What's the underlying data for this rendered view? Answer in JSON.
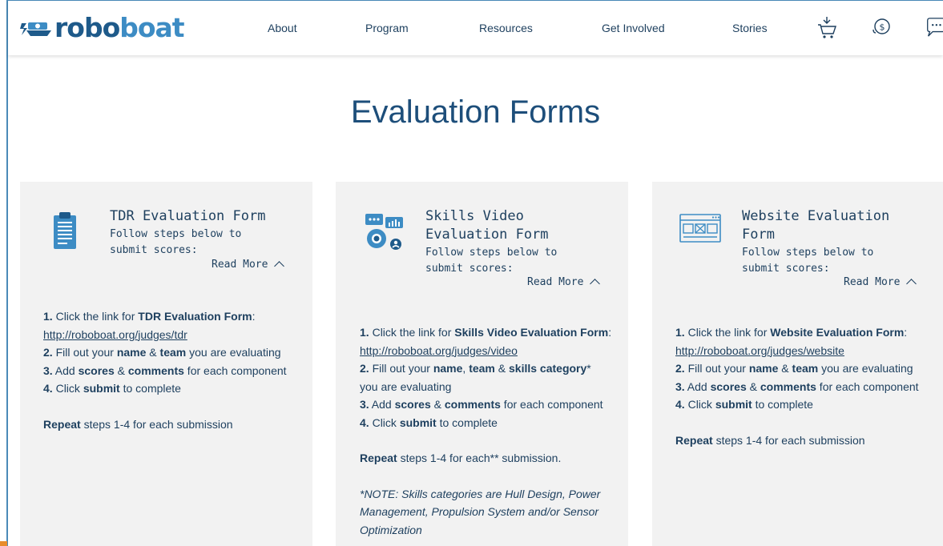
{
  "brand": {
    "logo_part1": "robo",
    "logo_part2": "boat"
  },
  "nav": {
    "items": [
      "About",
      "Program",
      "Resources",
      "Get Involved",
      "Stories"
    ],
    "icons": [
      "cart-icon",
      "donate-coin-icon",
      "chat-icon"
    ]
  },
  "page_title": "Evaluation Forms",
  "colors": {
    "primary": "#1d4e7a",
    "text": "#1d3f5e",
    "card_bg": "#f2f2f2",
    "icon_blue": "#3d8cc4"
  },
  "cards": [
    {
      "title_l1": "TDR Evaluation Form",
      "sub_l1": "Follow steps below to",
      "sub_l2": "submit scores:",
      "read_more": "Read More",
      "s1_num": "1.",
      "s1_a": " Click the link for ",
      "s1_b": "TDR Evaluation Form",
      "s1_c": ":",
      "link": "http://roboboat.org/judges/tdr ",
      "s2_num": "2.",
      "s2_a": " Fill out your ",
      "s2_b": "name",
      "s2_c": " & ",
      "s2_d": "team",
      "s2_e": " you are evaluating",
      "s3_num": "3.",
      "s3_a": " Add ",
      "s3_b": "scores",
      "s3_c": " & ",
      "s3_d": "comments",
      "s3_e": " for each component",
      "s4_num": "4.",
      "s4_a": " Click ",
      "s4_b": "submit",
      "s4_c": " to complete",
      "rep_b": "Repeat",
      "rep_a": " steps 1-4 for each submission"
    },
    {
      "title_l1": "Skills Video",
      "title_l2": "Evaluation Form",
      "sub_l1": "Follow steps below to",
      "sub_l2": "submit scores:",
      "read_more": "Read More",
      "s1_num": "1.",
      "s1_a": " Click the link for ",
      "s1_b": "Skills Video Evaluation Form",
      "s1_c": ":",
      "link": " http://roboboat.org/judges/video",
      "s2_num": "2.",
      "s2_a": " Fill out your ",
      "s2_b": "name",
      "s2_c": ", ",
      "s2_d": "team",
      "s2_e": " & ",
      "s2_f": "skills category",
      "s2_g": "* you are evaluating",
      "s3_num": "3.",
      "s3_a": " Add ",
      "s3_b": "scores",
      "s3_c": " & ",
      "s3_d": "comments",
      "s3_e": " for each component",
      "s4_num": "4.",
      "s4_a": " Click ",
      "s4_b": "submit",
      "s4_c": " to complete",
      "rep_b": "Repeat",
      "rep_a": " steps 1-4 for each** submission.",
      "note": "*NOTE: Skills categories are Hull Design, Power Management, Propulsion System and/or Sensor Optimization"
    },
    {
      "title_l1": "Website Evaluation",
      "title_l2": "Form",
      "sub_l1": "Follow steps below to",
      "sub_l2": "submit scores:",
      "read_more": "Read More",
      "s1_num": "1.",
      "s1_a": " Click the link for ",
      "s1_b": "Website Evaluation Form",
      "s1_c": ": ",
      "link": "http://roboboat.org/judges/website",
      "s2_num": "2.",
      "s2_a": " Fill out your ",
      "s2_b": "name",
      "s2_c": " & ",
      "s2_d": "team",
      "s2_e": " you are evaluating",
      "s3_num": "3.",
      "s3_a": " Add ",
      "s3_b": "scores",
      "s3_c": " & ",
      "s3_d": "comments",
      "s3_e": " for each component",
      "s4_num": "4.",
      "s4_a": " Click ",
      "s4_b": "submit",
      "s4_c": " to complete",
      "rep_b": "Repeat",
      "rep_a": " steps 1-4 for each submission"
    }
  ]
}
